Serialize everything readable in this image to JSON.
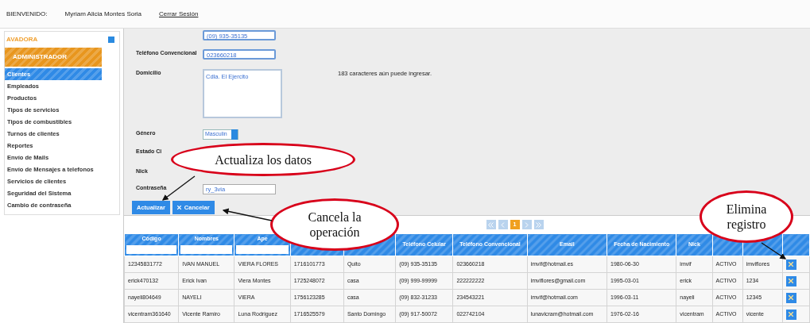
{
  "header": {
    "welcome_label": "BIENVENIDO:",
    "user_name": "Myriam Alicia Montes Soria",
    "logout_link": "Cerrar Sesión"
  },
  "sidebar": {
    "title": "AVADORA",
    "section": "ADMINISTRADOR",
    "items": [
      {
        "label": "Clientes",
        "selected": true
      },
      {
        "label": "Empleados",
        "selected": false
      },
      {
        "label": "Productos",
        "selected": false
      },
      {
        "label": "Tipos de servicios",
        "selected": false
      },
      {
        "label": "Tipos de combustibles",
        "selected": false
      },
      {
        "label": "Turnos de clientes",
        "selected": false
      },
      {
        "label": "Reportes",
        "selected": false
      },
      {
        "label": "Envío de Mails",
        "selected": false
      },
      {
        "label": "Envío de Mensajes a telefonos",
        "selected": false
      },
      {
        "label": "Servicios de clientes",
        "selected": false
      },
      {
        "label": "Seguridad del Sistema",
        "selected": false
      },
      {
        "label": "Cambio de contraseña",
        "selected": false
      }
    ]
  },
  "form": {
    "fields": [
      {
        "kind": "input",
        "value": "(09) 935-35135",
        "focused": true
      },
      {
        "kind": "input",
        "label": "Teléfono Convencional",
        "value": "023660218",
        "focused": true
      },
      {
        "kind": "textarea",
        "label": "Domicilio",
        "value": "Cdla. El Ejercito",
        "hint": "183 caracteres aún puede ingresar."
      },
      {
        "kind": "select",
        "label": "Género",
        "value": "Masculin"
      },
      {
        "kind": "covered",
        "label": "Estado Ci"
      },
      {
        "kind": "covered",
        "label": "Nick"
      },
      {
        "kind": "input",
        "label": "Contraseña",
        "value": "ry_3via",
        "focused": false
      }
    ],
    "buttons": [
      {
        "kind": "primary",
        "label": "Actualizar"
      },
      {
        "kind": "cancel",
        "label": "Cancelar"
      }
    ]
  },
  "pager": {
    "pages": [
      {
        "label": "1",
        "selected": true
      }
    ]
  },
  "table": {
    "columns": [
      {
        "title": "Código",
        "filter": true
      },
      {
        "title": "Nombres",
        "filter": true
      },
      {
        "title": "Ape",
        "filter": true
      },
      {
        "filter": false
      },
      {
        "filter": false
      },
      {
        "title": "Teléfono Celular",
        "filter": false
      },
      {
        "title": "Teléfono Convencional",
        "filter": false
      },
      {
        "title": "Email",
        "filter": false
      },
      {
        "title": "Fecha de Nacimiento",
        "filter": false
      },
      {
        "title": "Nick",
        "filter": false
      },
      {
        "filter": false
      },
      {
        "filter": false
      },
      {
        "filter": false
      }
    ],
    "rows": [
      [
        "12345831772",
        "IVAN MANUEL",
        "VIERA FLORES",
        "1716101773",
        "Quito",
        "(09) 935-35135",
        "023660218",
        "imvif@hotmail.es",
        "1980-06-30",
        "imvif",
        "ACTIVO",
        "imviflores"
      ],
      [
        "erick470132",
        "Erick Ivan",
        "Viera Montes",
        "1725248072",
        "casa",
        "(09) 999-99999",
        "222222222",
        "imviflores@gmail.com",
        "1995-03-01",
        "erick",
        "ACTIVO",
        "1234"
      ],
      [
        "nayeli804649",
        "NAYELI",
        "VIERA",
        "1756123285",
        "casa",
        "(09) 832-31233",
        "234543221",
        "imvif@hotmail.com",
        "1996-03-11",
        "nayeli",
        "ACTIVO",
        "12345"
      ],
      [
        "vicentram361640",
        "Vicente Ramiro",
        "Luna Rodriguez",
        "1716525579",
        "Santo Domingo",
        "(09) 917-50072",
        "022742104",
        "lunavicram@hotmail.com",
        "1976-02-16",
        "vicentram",
        "ACTIVO",
        "vicente"
      ]
    ]
  },
  "annotations": [
    {
      "text": "Actualiza los datos"
    },
    {
      "text": "Cancela la operación"
    },
    {
      "text": "Elimina registro"
    }
  ]
}
